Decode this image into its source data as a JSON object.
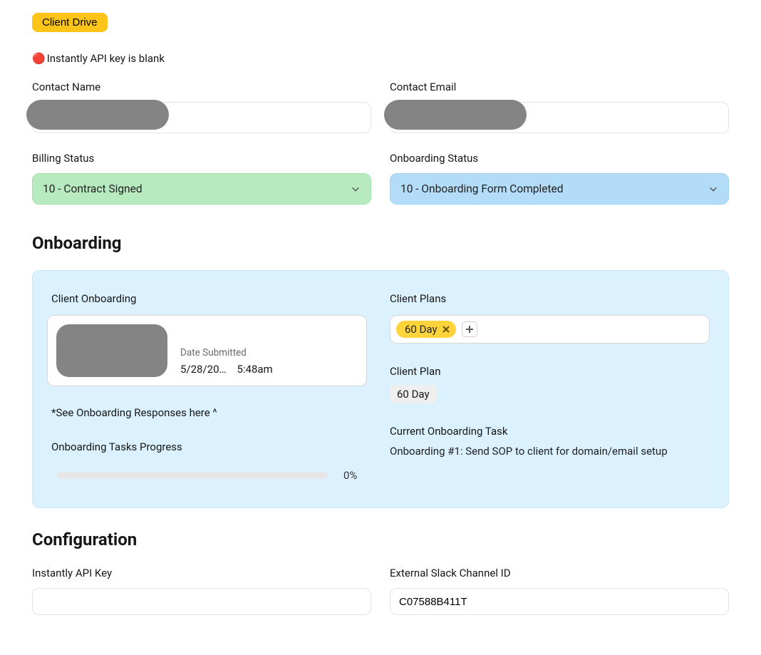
{
  "buttons": {
    "client_drive": "Client Drive"
  },
  "warning": {
    "icon": "🔴",
    "text": "Instantly API key is blank"
  },
  "fields": {
    "contact_name": {
      "label": "Contact Name",
      "value": ""
    },
    "contact_email": {
      "label": "Contact Email",
      "value": ""
    },
    "billing_status": {
      "label": "Billing Status",
      "value": "10 - Contract Signed"
    },
    "onboarding_status": {
      "label": "Onboarding Status",
      "value": "10 - Onboarding Form Completed"
    }
  },
  "sections": {
    "onboarding": "Onboarding",
    "configuration": "Configuration"
  },
  "onboarding": {
    "client_onboarding_label": "Client Onboarding",
    "date_submitted_label": "Date Submitted",
    "date": "5/28/20…",
    "time": "5:48am",
    "note": "*See Onboarding Responses here ^",
    "progress_label": "Onboarding Tasks Progress",
    "progress_pct": "0%",
    "client_plans_label": "Client Plans",
    "chips": [
      {
        "label": "60 Day"
      }
    ],
    "client_plan_label": "Client Plan",
    "client_plan_value": "60 Day",
    "current_task_label": "Current Onboarding Task",
    "current_task_value": "Onboarding #1:  Send SOP to client for domain/email setup"
  },
  "configuration": {
    "api_key_label": "Instantly API Key",
    "api_key_value": "",
    "slack_label": "External Slack Channel ID",
    "slack_value": "C07588B411T"
  }
}
